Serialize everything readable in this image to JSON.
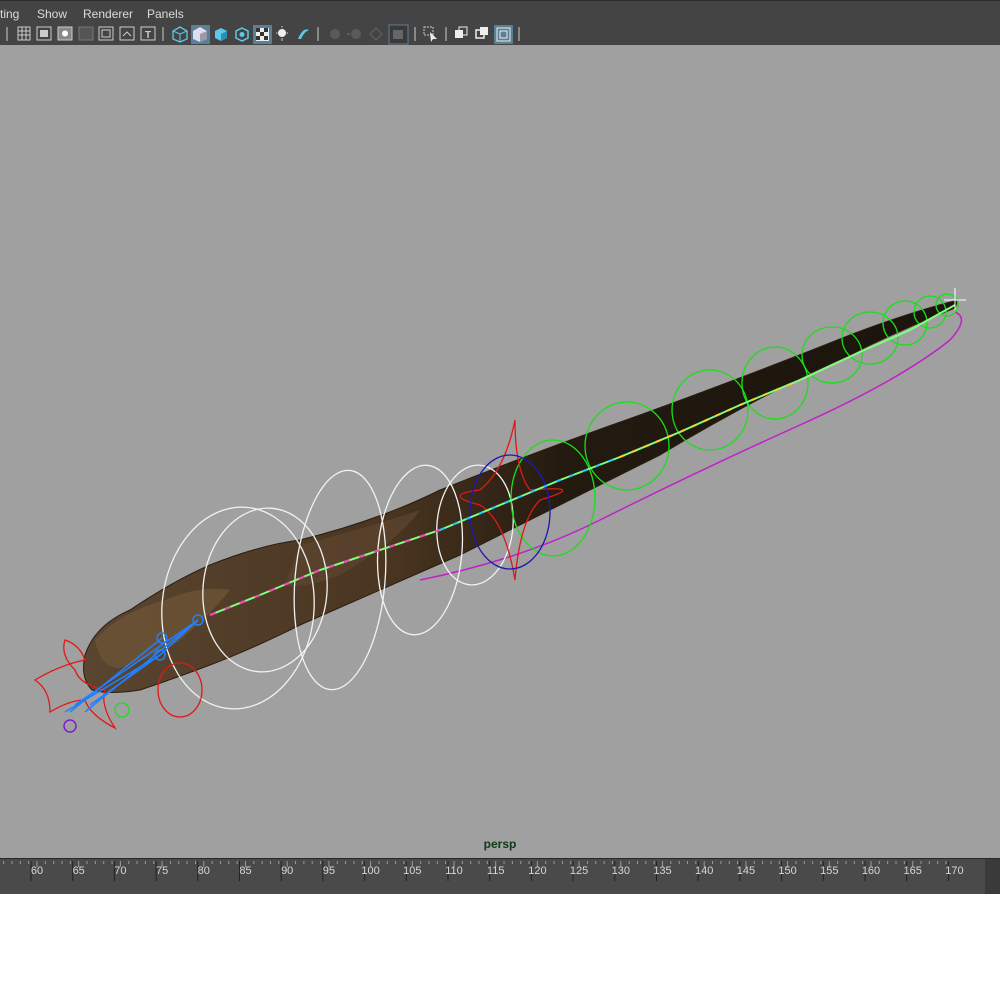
{
  "menu": {
    "items": [
      "ting",
      "Show",
      "Renderer",
      "Panels"
    ]
  },
  "toolbar": {
    "icons": [
      "camera-select-icon",
      "grid-icon",
      "film-gate-icon",
      "resolution-gate-icon",
      "gate-mask-icon",
      "field-chart-icon",
      "safe-action-icon",
      "safe-title-icon",
      "wireframe-icon",
      "smooth-shade-icon",
      "default-material-icon",
      "xray-icon",
      "textured-icon",
      "use-lights-icon",
      "shadows-icon",
      "ambient-occlusion-icon",
      "motion-blur-icon",
      "anti-aliasing-icon",
      "depth-of-field-icon",
      "isolate-select-icon",
      "xray-joints-icon",
      "xray-active-icon",
      "hud-icon"
    ]
  },
  "viewport": {
    "camera_label": "persp",
    "background_color": "#a0a0a0",
    "label_color": "#0e3a16"
  },
  "timeline": {
    "ticks": [
      "60",
      "65",
      "70",
      "75",
      "80",
      "85",
      "90",
      "95",
      "100",
      "105",
      "110",
      "115",
      "120",
      "125",
      "130",
      "135",
      "140",
      "145",
      "150",
      "155",
      "160",
      "165",
      "170"
    ]
  },
  "colors": {
    "control_green": "#18e018",
    "control_white": "#f2f2f2",
    "control_red": "#e01818",
    "control_blue": "#1a1ab0",
    "control_magenta": "#c020c8",
    "joint_blue": "#2080ff",
    "snake_skin": "#3a2a1a"
  }
}
